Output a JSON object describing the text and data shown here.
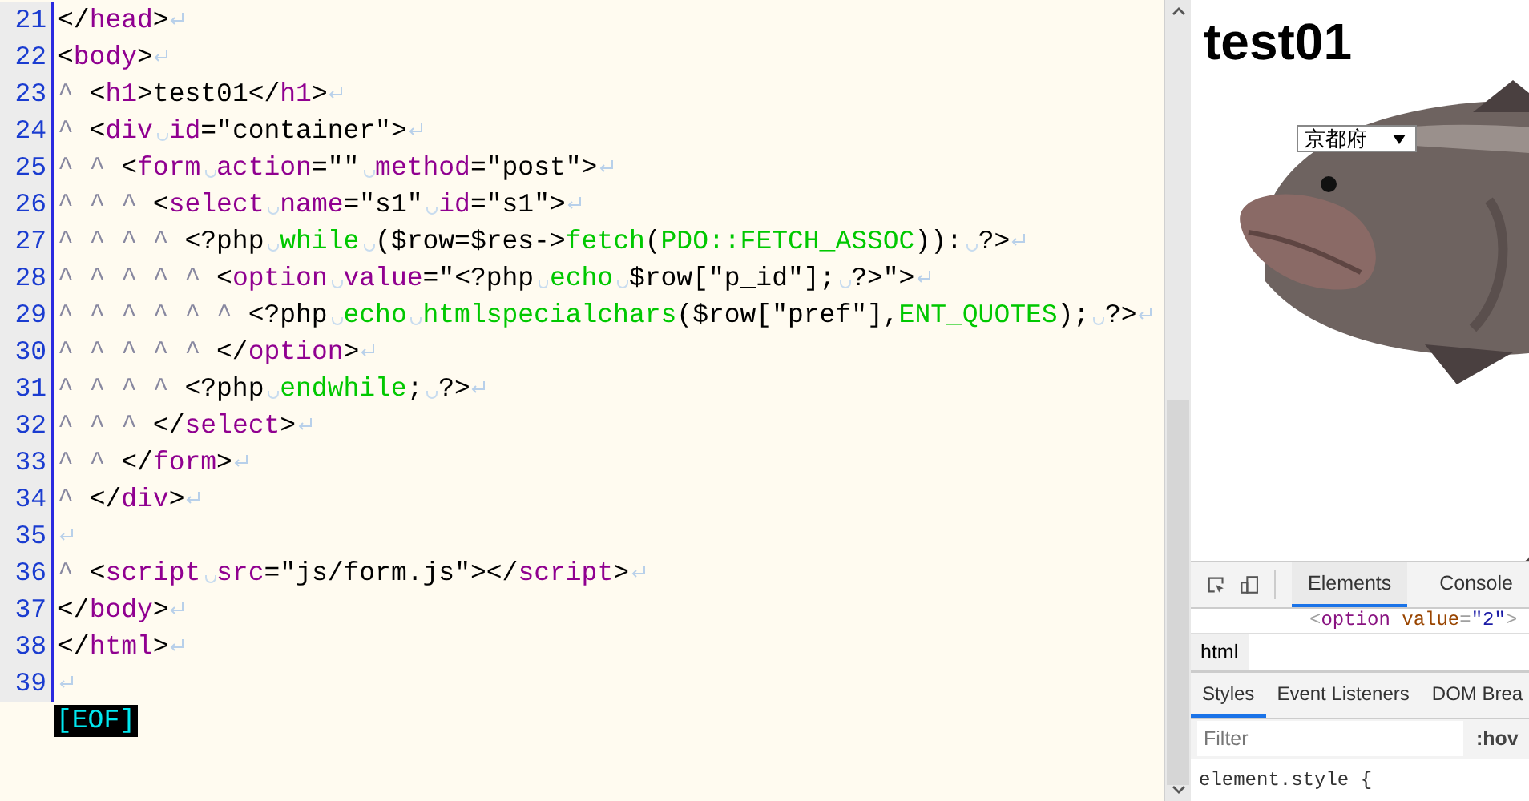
{
  "editor": {
    "lines": [
      {
        "number": "21",
        "tokens": [
          {
            "kind": "plain",
            "text": "</"
          },
          {
            "kind": "tag",
            "text": "head"
          },
          {
            "kind": "plain",
            "text": ">"
          }
        ]
      },
      {
        "number": "22",
        "tokens": [
          {
            "kind": "plain",
            "text": "<"
          },
          {
            "kind": "tag",
            "text": "body"
          },
          {
            "kind": "plain",
            "text": ">"
          }
        ]
      },
      {
        "number": "23",
        "tokens": [
          {
            "kind": "indent",
            "text": "^ "
          },
          {
            "kind": "plain",
            "text": "<"
          },
          {
            "kind": "tag",
            "text": "h1"
          },
          {
            "kind": "plain",
            "text": ">test01</"
          },
          {
            "kind": "tag",
            "text": "h1"
          },
          {
            "kind": "plain",
            "text": ">"
          }
        ]
      },
      {
        "number": "24",
        "tokens": [
          {
            "kind": "indent",
            "text": "^ "
          },
          {
            "kind": "plain",
            "text": "<"
          },
          {
            "kind": "tag",
            "text": "div"
          },
          {
            "kind": "space"
          },
          {
            "kind": "tag",
            "text": "id"
          },
          {
            "kind": "plain",
            "text": "=\"container\">"
          }
        ]
      },
      {
        "number": "25",
        "tokens": [
          {
            "kind": "indent",
            "text": "^ ^ "
          },
          {
            "kind": "plain",
            "text": "<"
          },
          {
            "kind": "tag",
            "text": "form"
          },
          {
            "kind": "space"
          },
          {
            "kind": "tag",
            "text": "action"
          },
          {
            "kind": "plain",
            "text": "=\"\""
          },
          {
            "kind": "space"
          },
          {
            "kind": "tag",
            "text": "method"
          },
          {
            "kind": "plain",
            "text": "=\"post\">"
          }
        ]
      },
      {
        "number": "26",
        "tokens": [
          {
            "kind": "indent",
            "text": "^ ^ ^ "
          },
          {
            "kind": "plain",
            "text": "<"
          },
          {
            "kind": "tag",
            "text": "select"
          },
          {
            "kind": "space"
          },
          {
            "kind": "tag",
            "text": "name"
          },
          {
            "kind": "plain",
            "text": "=\"s1\""
          },
          {
            "kind": "space"
          },
          {
            "kind": "tag",
            "text": "id"
          },
          {
            "kind": "plain",
            "text": "=\"s1\">"
          }
        ]
      },
      {
        "number": "27",
        "tokens": [
          {
            "kind": "indent",
            "text": "^ ^ ^ ^ "
          },
          {
            "kind": "plain",
            "text": "<?php"
          },
          {
            "kind": "space"
          },
          {
            "kind": "php",
            "text": "while"
          },
          {
            "kind": "space"
          },
          {
            "kind": "plain",
            "text": "($row=$res->"
          },
          {
            "kind": "php",
            "text": "fetch"
          },
          {
            "kind": "plain",
            "text": "("
          },
          {
            "kind": "php",
            "text": "PDO::FETCH_ASSOC"
          },
          {
            "kind": "plain",
            "text": ")):"
          },
          {
            "kind": "space"
          },
          {
            "kind": "plain",
            "text": "?>"
          }
        ]
      },
      {
        "number": "28",
        "tokens": [
          {
            "kind": "indent",
            "text": "^ ^ ^ ^ ^ "
          },
          {
            "kind": "plain",
            "text": "<"
          },
          {
            "kind": "tag",
            "text": "option"
          },
          {
            "kind": "space"
          },
          {
            "kind": "tag",
            "text": "value"
          },
          {
            "kind": "plain",
            "text": "=\"<?php"
          },
          {
            "kind": "space"
          },
          {
            "kind": "php",
            "text": "echo"
          },
          {
            "kind": "space"
          },
          {
            "kind": "plain",
            "text": "$row[\"p_id\"];"
          },
          {
            "kind": "space"
          },
          {
            "kind": "plain",
            "text": "?>\">"
          }
        ]
      },
      {
        "number": "29",
        "tokens": [
          {
            "kind": "indent",
            "text": "^ ^ ^ ^ ^ ^ "
          },
          {
            "kind": "plain",
            "text": "<?php"
          },
          {
            "kind": "space"
          },
          {
            "kind": "php",
            "text": "echo"
          },
          {
            "kind": "space"
          },
          {
            "kind": "php",
            "text": "htmlspecialchars"
          },
          {
            "kind": "plain",
            "text": "($row[\"pref\"],"
          },
          {
            "kind": "php",
            "text": "ENT_QUOTES"
          },
          {
            "kind": "plain",
            "text": ");"
          },
          {
            "kind": "space"
          },
          {
            "kind": "plain",
            "text": "?>"
          }
        ]
      },
      {
        "number": "30",
        "tokens": [
          {
            "kind": "indent",
            "text": "^ ^ ^ ^ ^ "
          },
          {
            "kind": "plain",
            "text": "</"
          },
          {
            "kind": "tag",
            "text": "option"
          },
          {
            "kind": "plain",
            "text": ">"
          }
        ]
      },
      {
        "number": "31",
        "tokens": [
          {
            "kind": "indent",
            "text": "^ ^ ^ ^ "
          },
          {
            "kind": "plain",
            "text": "<?php"
          },
          {
            "kind": "space"
          },
          {
            "kind": "php",
            "text": "endwhile"
          },
          {
            "kind": "plain",
            "text": ";"
          },
          {
            "kind": "space"
          },
          {
            "kind": "plain",
            "text": "?>"
          }
        ]
      },
      {
        "number": "32",
        "tokens": [
          {
            "kind": "indent",
            "text": "^ ^ ^ "
          },
          {
            "kind": "plain",
            "text": "</"
          },
          {
            "kind": "tag",
            "text": "select"
          },
          {
            "kind": "plain",
            "text": ">"
          }
        ]
      },
      {
        "number": "33",
        "tokens": [
          {
            "kind": "indent",
            "text": "^ ^ "
          },
          {
            "kind": "plain",
            "text": "</"
          },
          {
            "kind": "tag",
            "text": "form"
          },
          {
            "kind": "plain",
            "text": ">"
          }
        ]
      },
      {
        "number": "34",
        "tokens": [
          {
            "kind": "indent",
            "text": "^ "
          },
          {
            "kind": "plain",
            "text": "</"
          },
          {
            "kind": "tag",
            "text": "div"
          },
          {
            "kind": "plain",
            "text": ">"
          }
        ]
      },
      {
        "number": "35"
      },
      {
        "number": "36",
        "tokens": [
          {
            "kind": "indent",
            "text": "^ "
          },
          {
            "kind": "plain",
            "text": "<"
          },
          {
            "kind": "tag",
            "text": "script"
          },
          {
            "kind": "space"
          },
          {
            "kind": "tag",
            "text": "src"
          },
          {
            "kind": "plain",
            "text": "=\"js/form.js\"></"
          },
          {
            "kind": "tag",
            "text": "script"
          },
          {
            "kind": "plain",
            "text": ">"
          }
        ]
      },
      {
        "number": "37",
        "tokens": [
          {
            "kind": "plain",
            "text": "</"
          },
          {
            "kind": "tag",
            "text": "body"
          },
          {
            "kind": "plain",
            "text": ">"
          }
        ]
      },
      {
        "number": "38",
        "tokens": [
          {
            "kind": "plain",
            "text": "</"
          },
          {
            "kind": "tag",
            "text": "html"
          },
          {
            "kind": "plain",
            "text": ">"
          }
        ]
      },
      {
        "number": "39"
      }
    ],
    "eof": "[EOF]"
  },
  "browser": {
    "heading": "test01",
    "select": {
      "value": "京都府"
    }
  },
  "devtools": {
    "tabs": [
      {
        "label": "Elements",
        "selected": true
      },
      {
        "label": "Console",
        "selected": false
      }
    ],
    "dom_line": [
      {
        "kind": "punct",
        "text": "<"
      },
      {
        "kind": "tag",
        "text": "option"
      },
      {
        "kind": "attr",
        "text": " value"
      },
      {
        "kind": "punct",
        "text": "="
      },
      {
        "kind": "val",
        "text": "\"2\""
      },
      {
        "kind": "punct",
        "text": ">"
      }
    ],
    "breadcrumb": "html",
    "style_tabs": [
      {
        "label": "Styles",
        "selected": true
      },
      {
        "label": "Event Listeners",
        "selected": false
      },
      {
        "label": "DOM Brea",
        "selected": false
      }
    ],
    "filter": {
      "placeholder": "Filter"
    },
    "hov": ":hov",
    "rule": "element.style {"
  }
}
